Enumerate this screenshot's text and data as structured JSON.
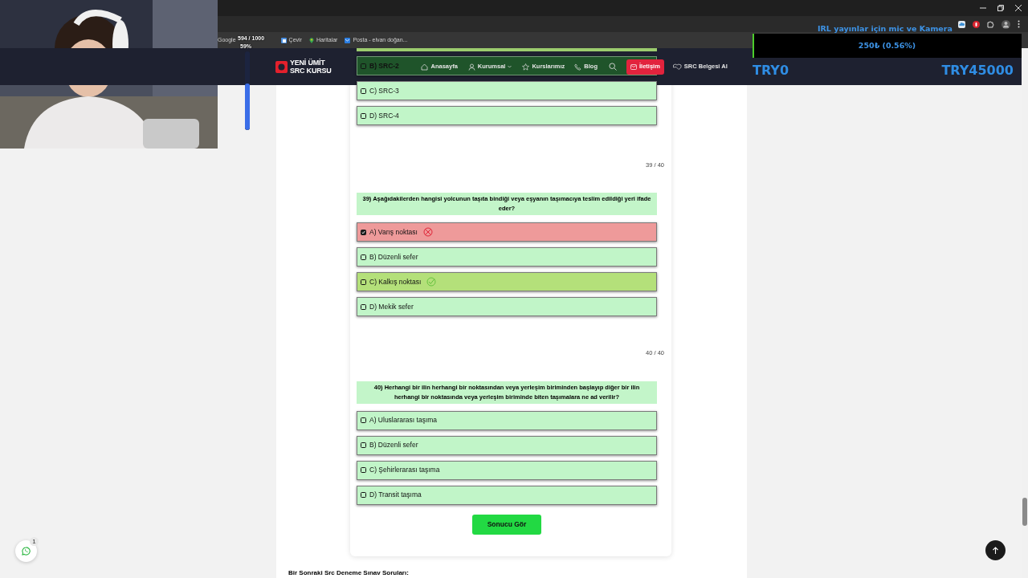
{
  "browser": {
    "bookmarks": [
      "Google",
      "Çevir",
      "Haritalar",
      "Posta - elvan doğan..."
    ]
  },
  "stream_overlay": {
    "goal_bar": {
      "label": "594 / 1000",
      "percent": "59%",
      "level": 0.59
    },
    "ticker": "IRL yayınlar için mic ve Kamera",
    "donation_bar": {
      "label": "250₺ (0.56%)",
      "level": 0.0056
    },
    "min_label": "TRY0",
    "max_label": "TRY45000"
  },
  "site": {
    "logo": [
      "YENİ ÜMİT",
      "SRC KURSU"
    ],
    "nav": [
      {
        "label": "Anasayfa",
        "dropdown": false
      },
      {
        "label": "Kurumsal",
        "dropdown": true
      },
      {
        "label": "Kurslarımız",
        "dropdown": false
      },
      {
        "label": "Blog",
        "dropdown": false
      }
    ],
    "contact_button": "İletişim",
    "cta_link": "SRC Belgesi Al"
  },
  "quiz": {
    "questions": [
      {
        "options": [
          {
            "label": "B) SRC-2",
            "checked": false,
            "kind": "plain"
          },
          {
            "label": "C) SRC-3",
            "checked": false,
            "kind": "plain"
          },
          {
            "label": "D) SRC-4",
            "checked": false,
            "kind": "plain"
          }
        ]
      },
      {
        "counter": "39 / 40",
        "number": "39)",
        "text": "Aşağıdakilerden hangisi yolcunun taşıta bindiği veya eşyanın taşımacıya teslim edildiği yeri ifade eder?",
        "options": [
          {
            "label": "A) Varış noktası",
            "checked": true,
            "kind": "wrong"
          },
          {
            "label": "B) Düzenli sefer",
            "checked": false,
            "kind": "plain"
          },
          {
            "label": "C) Kalkış noktası",
            "checked": false,
            "kind": "correct"
          },
          {
            "label": "D) Mekik sefer",
            "checked": false,
            "kind": "plain"
          }
        ]
      },
      {
        "counter": "40 / 40",
        "number": "40)",
        "text": "Herhangi bir ilin herhangi bir noktasından veya yerleşim biriminden başlayıp diğer bir ilin herhangi bir noktasında veya yerleşim biriminde biten taşımalara ne ad verilir?",
        "options": [
          {
            "label": "A) Uluslararası taşıma",
            "checked": false,
            "kind": "plain"
          },
          {
            "label": "B) Düzenli sefer",
            "checked": false,
            "kind": "plain"
          },
          {
            "label": "C) Şehirlerarası taşıma",
            "checked": false,
            "kind": "plain"
          },
          {
            "label": "D) Transit taşıma",
            "checked": false,
            "kind": "plain"
          }
        ]
      }
    ],
    "submit_button": "Sonucu Gör"
  },
  "next_heading": "Bir Sonraki Src Deneme Sınav Soruları:",
  "whatsapp": {
    "badge": "1"
  }
}
